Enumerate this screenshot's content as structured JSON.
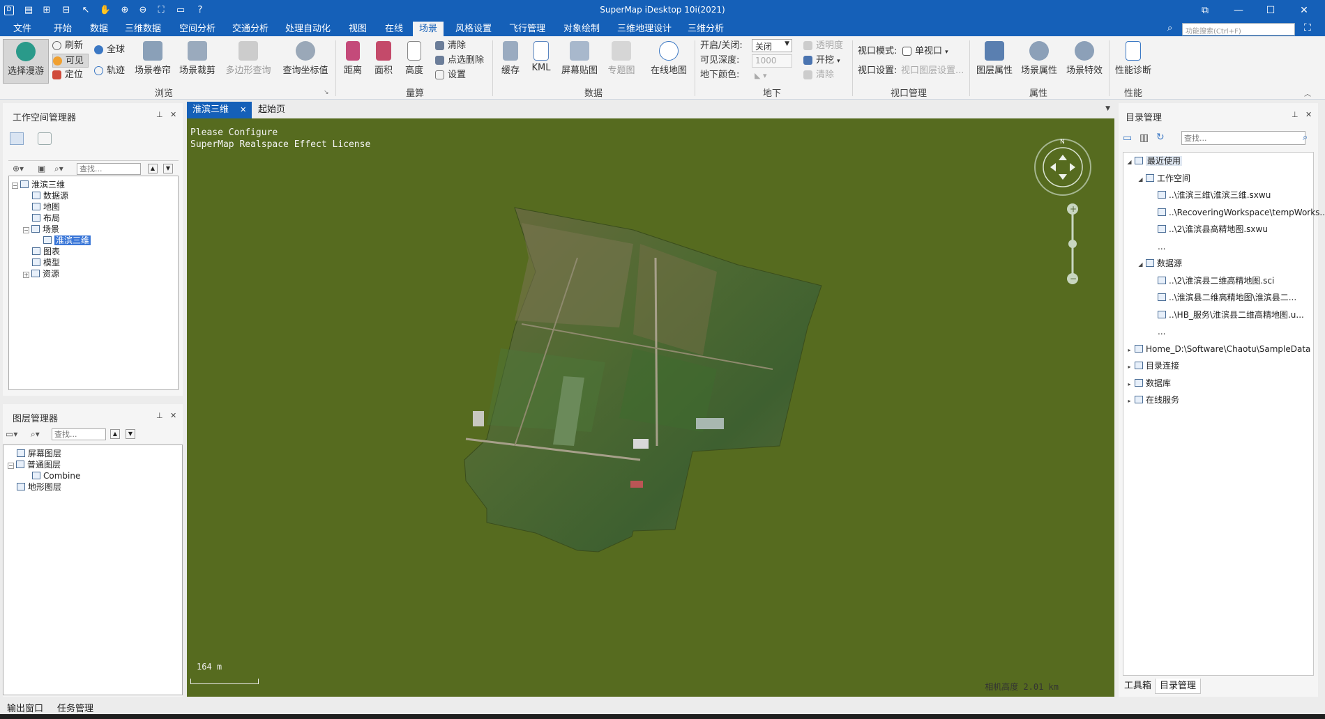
{
  "window": {
    "title": "SuperMap iDesktop 10i(2021)",
    "controls": [
      "⧉",
      "—",
      "☐",
      "✕"
    ]
  },
  "menu": {
    "tabs": [
      "文件",
      "开始",
      "数据",
      "三维数据",
      "空间分析",
      "交通分析",
      "处理自动化",
      "视图",
      "在线",
      "场景",
      "风格设置",
      "飞行管理",
      "对象绘制",
      "三维地理设计",
      "三维分析"
    ],
    "active": "场景",
    "search_placeholder": "功能搜索(Ctrl+F)"
  },
  "ribbon": {
    "browse": {
      "label": "浏览",
      "select_roam": "选择漫游",
      "refresh": "刷新",
      "visible": "可见",
      "locate": "定位",
      "full_globe": "全球",
      "track": "轨迹",
      "scene_roll": "场景卷帘",
      "scene_clip": "场景裁剪",
      "polygon_query": "多边形查询",
      "query_coord": "查询坐标值"
    },
    "measure": {
      "label": "量算",
      "distance": "距离",
      "area": "面积",
      "height": "高度",
      "clear": "清除",
      "point_delete": "点选删除",
      "settings": "设置"
    },
    "data": {
      "label": "数据",
      "cache": "缓存",
      "kml": "KML",
      "screen_overlay": "屏幕贴图",
      "thematic": "专题图",
      "online_map": "在线地图"
    },
    "underground": {
      "label": "地下",
      "on_off_label": "开启/关闭:",
      "on_off_value": "关闭",
      "visible_depth_label": "可见深度:",
      "visible_depth_value": "1000",
      "ground_color_label": "地下颜色:",
      "transparency": "透明度",
      "excavate": "开挖",
      "clear": "清除"
    },
    "viewport": {
      "label": "视口管理",
      "mode_label": "视口模式:",
      "mode_value": "单视口",
      "settings_label": "视口设置:",
      "layer_settings": "视口图层设置..."
    },
    "attributes": {
      "label": "属性",
      "layer_props": "图层属性",
      "scene_props": "场景属性",
      "scene_effects": "场景特效"
    },
    "performance": {
      "label": "性能",
      "diagnosis": "性能诊断"
    }
  },
  "workspace_manager": {
    "title": "工作空间管理器",
    "search_placeholder": "查找...",
    "tree": [
      {
        "label": "淮滨三维",
        "level": 0,
        "expand": "−"
      },
      {
        "label": "数据源",
        "level": 1,
        "expand": ""
      },
      {
        "label": "地图",
        "level": 1,
        "expand": ""
      },
      {
        "label": "布局",
        "level": 1,
        "expand": ""
      },
      {
        "label": "场景",
        "level": 1,
        "expand": "−"
      },
      {
        "label": "淮滨三维",
        "level": 2,
        "expand": "",
        "selected": true
      },
      {
        "label": "图表",
        "level": 1,
        "expand": ""
      },
      {
        "label": "模型",
        "level": 1,
        "expand": ""
      },
      {
        "label": "资源",
        "level": 1,
        "expand": "+"
      }
    ]
  },
  "layer_manager": {
    "title": "图层管理器",
    "search_placeholder": "查找...",
    "tree": [
      {
        "label": "屏幕图层",
        "level": 0,
        "expand": ""
      },
      {
        "label": "普通图层",
        "level": 0,
        "expand": "−"
      },
      {
        "label": "Combine",
        "level": 1,
        "expand": ""
      },
      {
        "label": "地形图层",
        "level": 0,
        "expand": ""
      }
    ]
  },
  "doc_tabs": {
    "active": "淮滨三维",
    "other": "起始页",
    "dropdown": "▼"
  },
  "scene": {
    "license_line1": "Please Configure",
    "license_line2": "SuperMap Realspace Effect License",
    "scale_label": "164 m",
    "altitude": "相机高度 2.01 km",
    "compass_north": "N",
    "zoom_in": "+",
    "zoom_out": "−",
    "bg_color": "#566b1f"
  },
  "catalog": {
    "title": "目录管理",
    "search_placeholder": "查找...",
    "tree": [
      {
        "label": "最近使用",
        "level": 0,
        "expand": "◢",
        "selected": true
      },
      {
        "label": "工作空间",
        "level": 1,
        "expand": "◢"
      },
      {
        "label": "..\\淮滨三维\\淮滨三维.sxwu",
        "level": 2,
        "expand": ""
      },
      {
        "label": "..\\RecoveringWorkspace\\tempWorks...",
        "level": 2,
        "expand": ""
      },
      {
        "label": "..\\2\\淮滨县高精地图.sxwu",
        "level": 2,
        "expand": ""
      },
      {
        "label": "...",
        "level": 2,
        "expand": "",
        "noicon": true
      },
      {
        "label": "数据源",
        "level": 1,
        "expand": "◢"
      },
      {
        "label": "..\\2\\淮滨县二维高精地图.sci",
        "level": 2,
        "expand": ""
      },
      {
        "label": "..\\淮滨县二维高精地图\\淮滨县二...",
        "level": 2,
        "expand": ""
      },
      {
        "label": "..\\HB_服务\\淮滨县二维高精地图.u...",
        "level": 2,
        "expand": ""
      },
      {
        "label": "...",
        "level": 2,
        "expand": "",
        "noicon": true
      },
      {
        "label": "Home_D:\\Software\\Chaotu\\SampleData",
        "level": 0,
        "expand": "▸"
      },
      {
        "label": "目录连接",
        "level": 0,
        "expand": "▸"
      },
      {
        "label": "数据库",
        "level": 0,
        "expand": "▸"
      },
      {
        "label": "在线服务",
        "level": 0,
        "expand": "▸"
      }
    ],
    "tabs": [
      "工具箱",
      "目录管理"
    ],
    "active_tab": "目录管理"
  },
  "bottom_tabs": [
    "输出窗口",
    "任务管理"
  ]
}
